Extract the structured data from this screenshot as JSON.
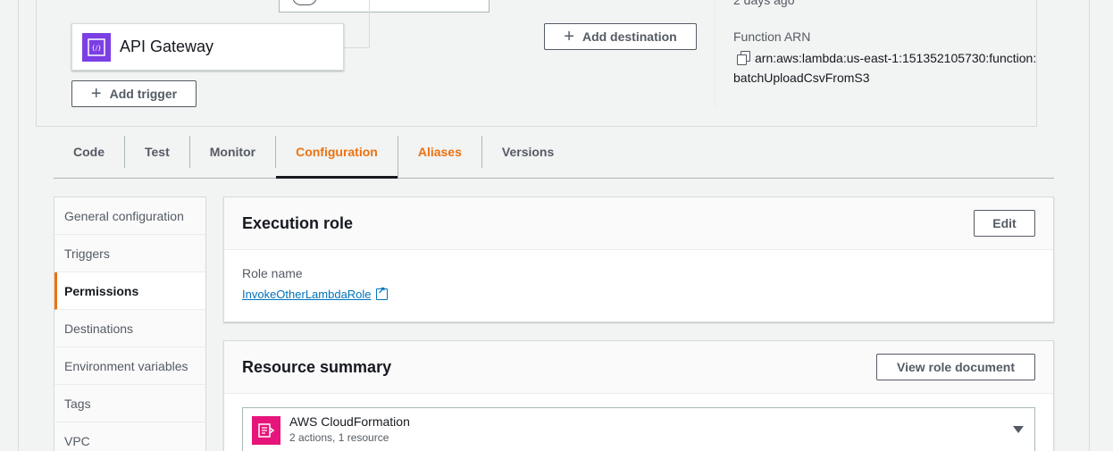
{
  "overview": {
    "trigger_name": "API Gateway",
    "add_trigger_label": "Add trigger",
    "add_destination_label": "Add destination",
    "last_modified_partial": "2 days ago",
    "arn_label": "Function ARN",
    "arn_value": "arn:aws:lambda:us-east-1:151352105730:function:batchUploadCsvFromS3"
  },
  "tabs": [
    {
      "label": "Code"
    },
    {
      "label": "Test"
    },
    {
      "label": "Monitor"
    },
    {
      "label": "Configuration"
    },
    {
      "label": "Aliases"
    },
    {
      "label": "Versions"
    }
  ],
  "sidenav": [
    {
      "label": "General configuration"
    },
    {
      "label": "Triggers"
    },
    {
      "label": "Permissions"
    },
    {
      "label": "Destinations"
    },
    {
      "label": "Environment variables"
    },
    {
      "label": "Tags"
    },
    {
      "label": "VPC"
    }
  ],
  "execution_role": {
    "title": "Execution role",
    "edit_label": "Edit",
    "role_name_label": "Role name",
    "role_name": "InvokeOtherLambdaRole"
  },
  "resource_summary": {
    "title": "Resource summary",
    "view_doc_label": "View role document",
    "items": [
      {
        "name": "AWS CloudFormation",
        "detail": "2 actions, 1 resource"
      }
    ]
  },
  "colors": {
    "accent": "#ec7211",
    "link": "#0073bb",
    "api_gateway": "#7b3fe4",
    "cloudformation": "#e7157b"
  }
}
